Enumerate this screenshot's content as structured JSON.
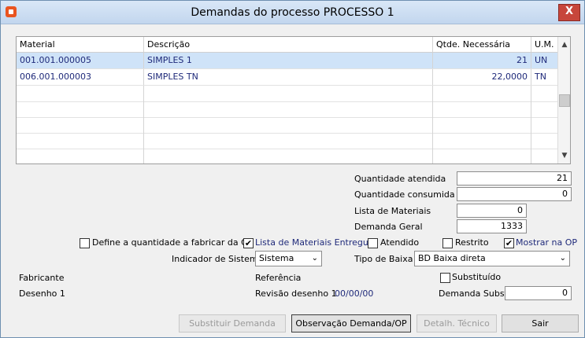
{
  "window": {
    "title": "Demandas do processo PROCESSO 1",
    "close_label": "X"
  },
  "grid": {
    "headers": [
      "Material",
      "Descrição",
      "Qtde. Necessária",
      "U.M."
    ],
    "rows": [
      {
        "material": "001.001.000005",
        "descricao": "SIMPLES 1",
        "qtde": "21",
        "um": "UN"
      },
      {
        "material": "006.001.000003",
        "descricao": "SIMPLES TN",
        "qtde": "22,0000",
        "um": "TN"
      }
    ]
  },
  "fields": {
    "qtd_atendida_label": "Quantidade atendida",
    "qtd_atendida": "21",
    "qtd_consumida_label": "Quantidade consumida",
    "qtd_consumida": "0",
    "lista_label": "Lista de Materiais",
    "lista": "0",
    "demanda_geral_label": "Demanda Geral",
    "demanda_geral": "1333"
  },
  "checkboxes": {
    "define_qtd": {
      "label": "Define a quantidade a fabricar da OP",
      "checked": false
    },
    "lista_entregue": {
      "label": "Lista de Materiais Entregue",
      "checked": true
    },
    "atendido": {
      "label": "Atendido",
      "checked": false
    },
    "restrito": {
      "label": "Restrito",
      "checked": false
    },
    "mostrar_op": {
      "label": "Mostrar na OP",
      "checked": true
    },
    "substituido": {
      "label": "Substituído",
      "checked": false
    }
  },
  "selects": {
    "indicador_label": "Indicador de Sistema",
    "indicador_value": "Sistema",
    "tipo_baixa_label": "Tipo de Baixa",
    "tipo_baixa_value": "BD Baixa direta"
  },
  "info": {
    "fabricante_label": "Fabricante",
    "referencia_label": "Referência",
    "desenho_label": "Desenho 1",
    "revisao_label": "Revisão desenho 1",
    "revisao_value": "00/00/00",
    "demanda_subst_label": "Demanda Subst.",
    "demanda_subst_value": "0"
  },
  "buttons": {
    "substituir": "Substituir Demanda",
    "observacao": "Observação Demanda/OP",
    "detalhe": "Detalh. Técnico",
    "sair": "Sair"
  }
}
